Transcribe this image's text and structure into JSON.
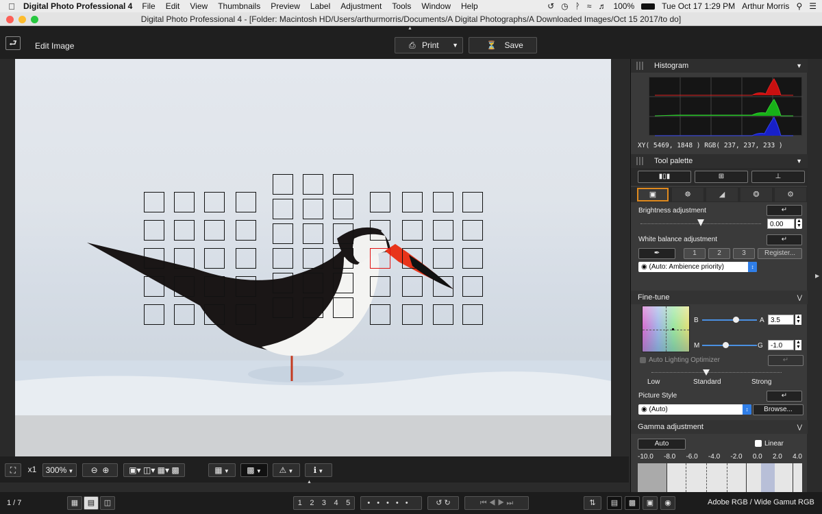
{
  "menubar": {
    "app_name": "Digital Photo Professional 4",
    "items": [
      "File",
      "Edit",
      "View",
      "Thumbnails",
      "Preview",
      "Label",
      "Adjustment",
      "Tools",
      "Window",
      "Help"
    ],
    "battery": "100%",
    "clock": "Tue Oct 17  1:29 PM",
    "user": "Arthur Morris"
  },
  "window": {
    "title": "Digital Photo Professional 4 - [Folder: Macintosh HD/Users/arthurmorris/Documents/A Digital Photographs/A Downloaded Images/Oct 15 2017/to do]"
  },
  "toolbar": {
    "title": "Edit Image",
    "print_label": "Print",
    "save_label": "Save"
  },
  "panel": {
    "histogram_title": "Histogram",
    "xy_readout": "XY(  5469,   1848 ) RGB( 237,  237,  233 )",
    "tool_palette_title": "Tool palette",
    "brightness_label": "Brightness adjustment",
    "brightness_value": "0.00",
    "brightness_level": 0.5,
    "wb_label": "White balance adjustment",
    "wb_btn1": "1",
    "wb_btn2": "2",
    "wb_btn3": "3",
    "wb_register": "Register...",
    "wb_select": "(Auto: Ambience priority)",
    "finetune_title": "Fine-tune",
    "b_label": "B",
    "a_label": "A",
    "a_value": "3.5",
    "m_label": "M",
    "g_label": "G",
    "g_value": "-1.0",
    "alo_label": "Auto Lighting Optimizer",
    "alo_low": "Low",
    "alo_standard": "Standard",
    "alo_strong": "Strong",
    "picture_style_label": "Picture Style",
    "picture_style_value": "(Auto)",
    "browse_label": "Browse...",
    "gamma_title": "Gamma adjustment",
    "gamma_auto": "Auto",
    "gamma_linear": "Linear",
    "gamma_ticks": [
      "-10.0",
      "-8.0",
      "-6.0",
      "-4.0",
      "-2.0",
      "0.0",
      "2.0",
      "4.0"
    ]
  },
  "bottom": {
    "zoom_x1": "x1",
    "zoom_level": "300%"
  },
  "footer": {
    "page_counter": "1 / 7",
    "ratings": [
      "1",
      "2",
      "3",
      "4",
      "5"
    ],
    "color_space": "Adobe RGB / Wide Gamut RGB"
  },
  "colors": {
    "accent_tab": "#e08a1e",
    "select_arrow": "#2f7ee8",
    "af_selected": "#e01010"
  }
}
